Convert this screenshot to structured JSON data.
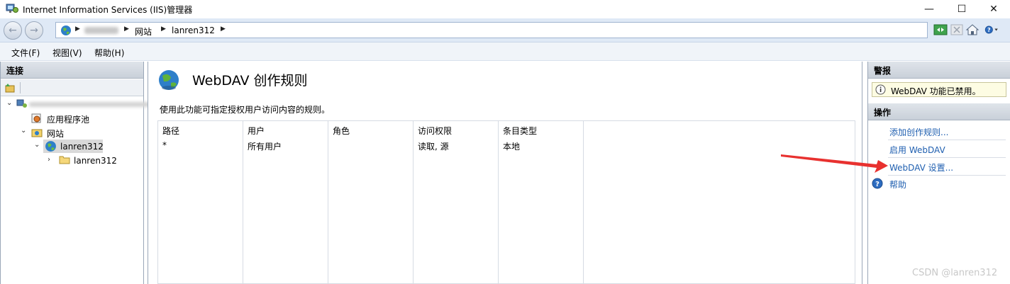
{
  "window": {
    "title": "Internet Information Services (IIS)管理器",
    "minimize": "—",
    "maximize": "☐",
    "close": "✕"
  },
  "address": {
    "crumbs": [
      "网站",
      "lanren312"
    ]
  },
  "menu": {
    "file": "文件(F)",
    "view": "视图(V)",
    "help": "帮助(H)"
  },
  "connections": {
    "header": "连接",
    "tree": {
      "app_pools": "应用程序池",
      "sites": "网站",
      "site": "lanren312",
      "folder": "lanren312"
    }
  },
  "feature": {
    "title": "WebDAV 创作规则",
    "description": "使用此功能可指定授权用户访问内容的规则。",
    "columns": [
      "路径",
      "用户",
      "角色",
      "访问权限",
      "条目类型"
    ],
    "rows": [
      [
        "*",
        "所有用户",
        "",
        "读取, 源",
        "本地"
      ]
    ]
  },
  "alerts": {
    "header": "警报",
    "message": "WebDAV 功能已禁用。"
  },
  "actions": {
    "header": "操作",
    "add_rule": "添加创作规则...",
    "enable": "启用 WebDAV",
    "settings": "WebDAV 设置...",
    "help": "帮助"
  },
  "watermark": "CSDN @lanren312",
  "colors": {
    "link": "#1f5fb0",
    "annotation_arrow": "#e8312f"
  }
}
